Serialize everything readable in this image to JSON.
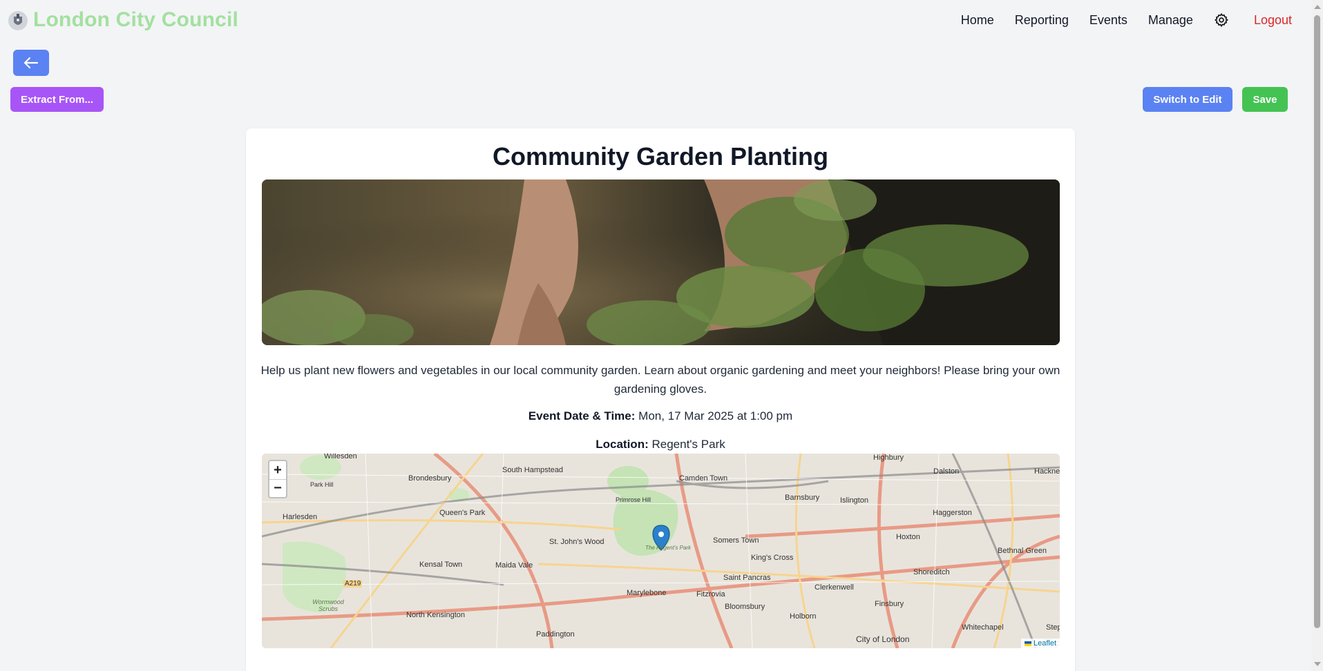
{
  "header": {
    "site_title": "London City Council",
    "nav": [
      "Home",
      "Reporting",
      "Events",
      "Manage"
    ],
    "logout": "Logout"
  },
  "toolbar": {
    "extract_label": "Extract From...",
    "switch_label": "Switch to Edit",
    "save_label": "Save"
  },
  "event": {
    "title": "Community Garden Planting",
    "description": "Help us plant new flowers and vegetables in our local community garden. Learn about organic gardening and meet your neighbors! Please bring your own gardening gloves.",
    "datetime_label": "Event Date & Time:",
    "datetime_value": "Mon, 17 Mar 2025 at 1:00 pm",
    "location_label": "Location:",
    "location_value": "Regent's Park"
  },
  "map": {
    "zoom_in": "+",
    "zoom_out": "−",
    "attribution": "Leaflet",
    "labels": [
      "Willesden",
      "Brondesbury",
      "South Hampstead",
      "Camden Town",
      "Highbury",
      "Dalston",
      "Hackney",
      "Park Hill",
      "Harlesden",
      "Queen's Park",
      "Primrose Hill",
      "Barnsbury",
      "Islington",
      "Haggerston",
      "St. John's Wood",
      "Somers Town",
      "Hoxton",
      "Kensal Town",
      "Maida Vale",
      "The Regent's Park",
      "King's Cross",
      "Bethnal Green",
      "A219",
      "Saint Pancras",
      "Shoreditch",
      "Wormwood Scrubs",
      "Marylebone",
      "Fitzrovia",
      "Clerkenwell",
      "Bloomsbury",
      "Finsbury",
      "North Kensington",
      "Holborn",
      "Paddington",
      "City of London",
      "Whitechapel",
      "Stepney"
    ]
  },
  "colors": {
    "primary": "#5b82f2",
    "purple": "#a855f7",
    "green": "#44c353",
    "title_green": "#a3e0a0",
    "logout_red": "#dc2626"
  }
}
